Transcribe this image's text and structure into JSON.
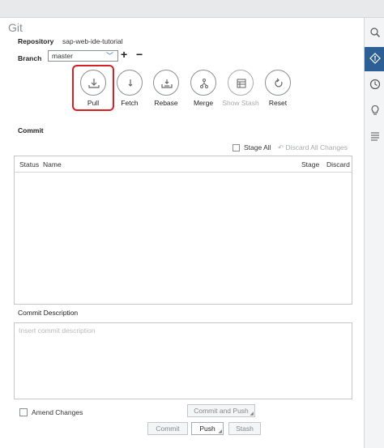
{
  "pane": {
    "title": "Git"
  },
  "repository": {
    "label": "Repository",
    "value": "sap-web-ide-tutorial"
  },
  "branch": {
    "label": "Branch",
    "selected": "master",
    "add": "+",
    "remove": "−"
  },
  "actions": [
    {
      "label": "Pull",
      "icon": "pull-icon",
      "enabled": true,
      "highlighted": true
    },
    {
      "label": "Fetch",
      "icon": "fetch-icon",
      "enabled": true
    },
    {
      "label": "Rebase",
      "icon": "rebase-icon",
      "enabled": true
    },
    {
      "label": "Merge",
      "icon": "merge-icon",
      "enabled": true
    },
    {
      "label": "Show Stash",
      "icon": "stash-icon",
      "enabled": false
    },
    {
      "label": "Reset",
      "icon": "reset-icon",
      "enabled": true
    }
  ],
  "commit": {
    "title": "Commit",
    "stage_all": "Stage All",
    "discard_all": "Discard All Changes",
    "columns": {
      "status": "Status",
      "name": "Name",
      "stage": "Stage",
      "discard": "Discard"
    },
    "rows": []
  },
  "description": {
    "title": "Commit Description",
    "placeholder": "Insert commit description"
  },
  "amend": {
    "label": "Amend Changes",
    "checked": false
  },
  "buttons": {
    "commit_and_push": "Commit and Push",
    "commit": "Commit",
    "push": "Push",
    "stash": "Stash"
  },
  "sidebar": [
    "search-icon",
    "git-icon",
    "history-icon",
    "lightbulb-icon",
    "outline-icon"
  ],
  "colors": {
    "accent": "#2c5f96",
    "highlight": "#d91f26"
  }
}
